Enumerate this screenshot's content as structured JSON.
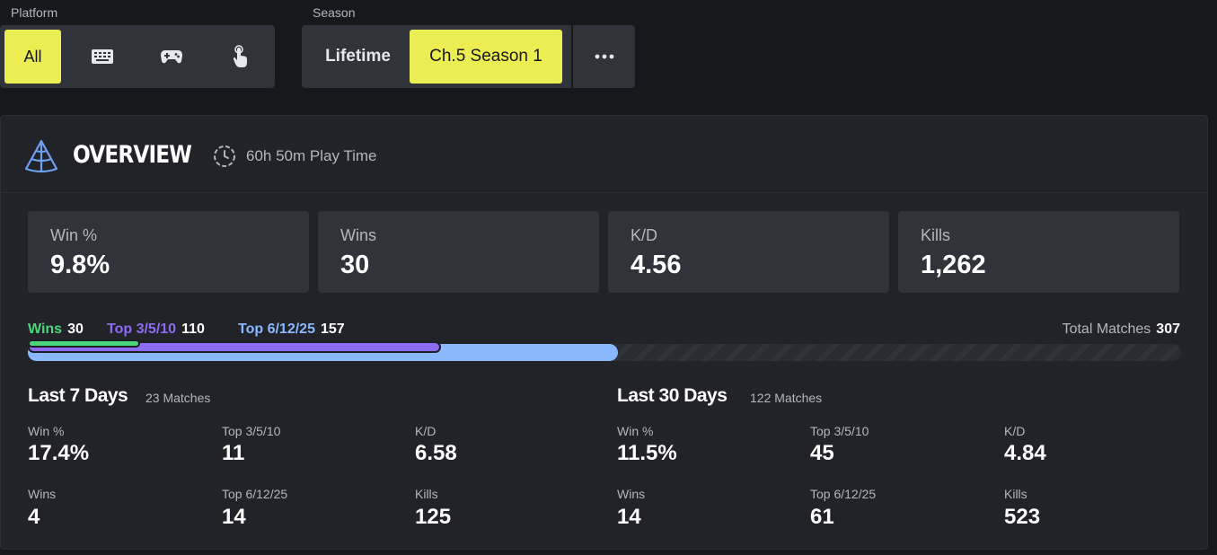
{
  "filters": {
    "platform_label": "Platform",
    "platform_all": "All",
    "season_label": "Season",
    "season_lifetime": "Lifetime",
    "season_current": "Ch.5 Season 1",
    "platform_icons": [
      "keyboard-icon",
      "gamepad-icon",
      "touch-icon"
    ],
    "more_icon": "more-icon"
  },
  "overview": {
    "title": "OVERVIEW",
    "playtime": "60h 50m Play Time",
    "stats": [
      {
        "label": "Win %",
        "value": "9.8%"
      },
      {
        "label": "Wins",
        "value": "30"
      },
      {
        "label": "K/D",
        "value": "4.56"
      },
      {
        "label": "Kills",
        "value": "1,262"
      }
    ]
  },
  "placements": {
    "wins_label": "Wins",
    "wins": "30",
    "top10_label": "Top 3/5/10",
    "top10": "110",
    "top25_label": "Top 6/12/25",
    "top25": "157",
    "total_label": "Total Matches",
    "total": "307"
  },
  "last7": {
    "title": "Last 7 Days",
    "matches": "23 Matches",
    "win_pct_label": "Win %",
    "win_pct": "17.4%",
    "top10_label": "Top 3/5/10",
    "top10": "11",
    "kd_label": "K/D",
    "kd": "6.58",
    "wins_label": "Wins",
    "wins": "4",
    "top25_label": "Top 6/12/25",
    "top25": "14",
    "kills_label": "Kills",
    "kills": "125"
  },
  "last30": {
    "title": "Last 30 Days",
    "matches": "122 Matches",
    "win_pct_label": "Win %",
    "win_pct": "11.5%",
    "top10_label": "Top 3/5/10",
    "top10": "45",
    "kd_label": "K/D",
    "kd": "4.84",
    "wins_label": "Wins",
    "wins": "14",
    "top25_label": "Top 6/12/25",
    "top25": "61",
    "kills_label": "Kills",
    "kills": "523"
  },
  "colors": {
    "accent": "#ecec53",
    "wins": "#4ad67a",
    "top10": "#8c6cf2",
    "top25": "#8ab8ff",
    "brand_icon": "#6ea0f0"
  }
}
